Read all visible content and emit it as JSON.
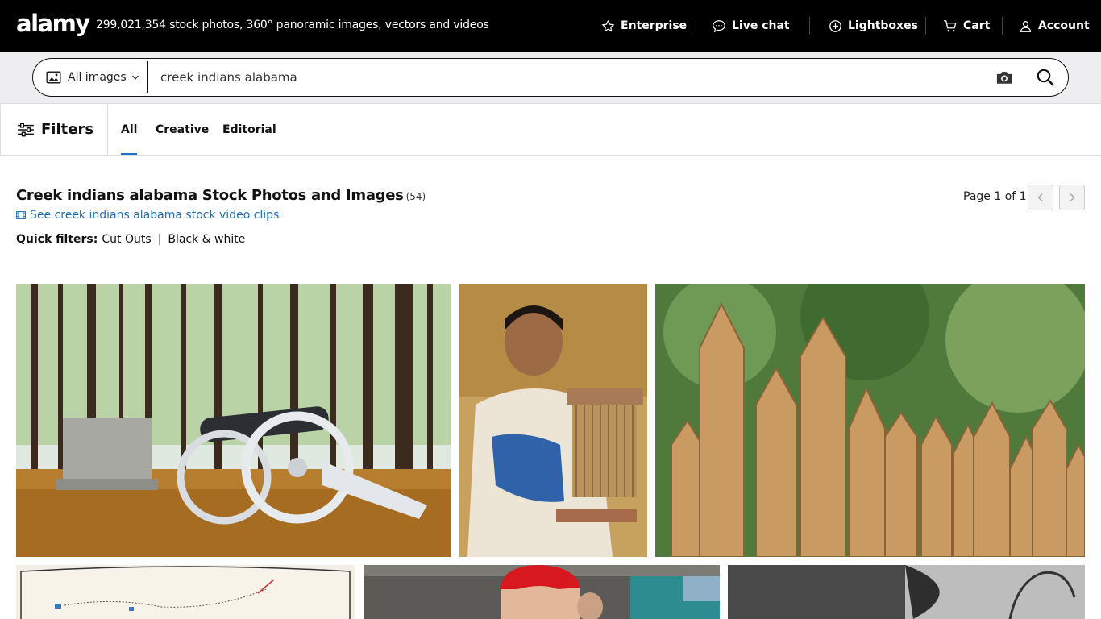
{
  "header": {
    "logo": "alamy",
    "tagline": "299,021,354 stock photos, 360° panoramic images, vectors and videos",
    "nav": [
      {
        "label": "Enterprise",
        "icon": "star-icon"
      },
      {
        "label": "Live chat",
        "icon": "chat-icon"
      },
      {
        "label": "Lightboxes",
        "icon": "plus-circle-icon"
      },
      {
        "label": "Cart",
        "icon": "cart-icon"
      },
      {
        "label": "Account",
        "icon": "user-icon"
      }
    ]
  },
  "search": {
    "type_label": "All images",
    "query": "creek indians alabama"
  },
  "filters": {
    "label": "Filters",
    "tabs": [
      {
        "label": "All",
        "active": true
      },
      {
        "label": "Creative",
        "active": false
      },
      {
        "label": "Editorial",
        "active": false
      }
    ]
  },
  "results": {
    "title": "Creek indians alabama Stock Photos and Images",
    "count": "(54)",
    "video_link": "See creek indians alabama stock video clips",
    "quick_filters_label": "Quick filters:",
    "quick_filters": [
      "Cut Outs",
      "Black & white"
    ],
    "page_info": "Page 1 of 1"
  },
  "colors": {
    "header_bg": "#000000",
    "search_band": "#eeeef0",
    "link": "#1e6fb8",
    "tab_underline": "#1e72c4"
  }
}
